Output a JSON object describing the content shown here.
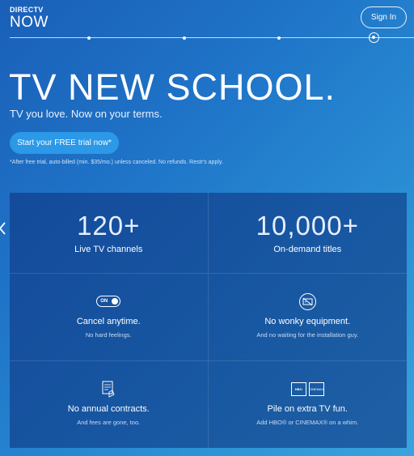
{
  "header": {
    "logo_line1": "DIRECTV",
    "logo_line2": "NOW",
    "signin_label": "Sign In"
  },
  "hero": {
    "headline": "TV NEW SCHOOL.",
    "tagline": "TV you love. Now on your terms.",
    "cta_label": "Start your FREE trial now*",
    "disclaimer": "*After free trial, auto-billed (min. $35/mo.) unless canceled. No refunds. Restr's apply."
  },
  "features": [
    {
      "big": "120+",
      "title": "Live TV channels"
    },
    {
      "big": "10,000+",
      "title": "On-demand titles"
    },
    {
      "icon": "on-toggle-icon",
      "toggle_text": "ON",
      "title": "Cancel anytime.",
      "sub": "No hard feelings."
    },
    {
      "icon": "cable-box-icon",
      "title": "No wonky equipment.",
      "sub": "And no waiting for the installation guy."
    },
    {
      "icon": "contract-icon",
      "title": "No annual contracts.",
      "sub": "And fees are gone, too."
    },
    {
      "icon": "premium-channels-icon",
      "badge1": "HBO",
      "badge2": "CINEMAX",
      "title": "Pile on extra TV fun.",
      "sub": "Add HBO® or CINEMAX® on a whim."
    }
  ],
  "colors": {
    "bg_start": "#1a5fb8",
    "bg_end": "#3aa3dc",
    "cta": "#2b98e8"
  }
}
